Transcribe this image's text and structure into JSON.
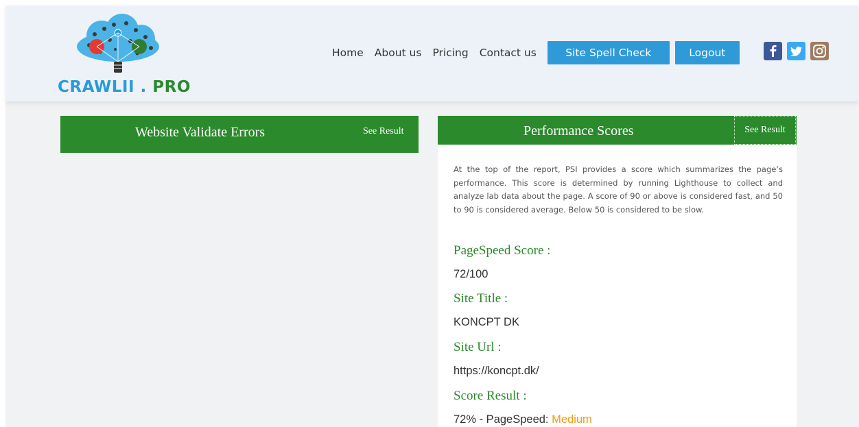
{
  "brand": {
    "name_part1": "CRAWLII . ",
    "name_part2": "PRO"
  },
  "nav": {
    "links": [
      "Home",
      "About us",
      "Pricing",
      "Contact us"
    ],
    "spell_check_label": "Site Spell Check",
    "logout_label": "Logout"
  },
  "social": [
    "facebook-icon",
    "twitter-icon",
    "instagram-icon"
  ],
  "colors": {
    "header_bg": "#edf2f9",
    "panel_green": "#2b8a2c",
    "button_blue": "#2f9ad8",
    "medium_orange": "#f39c12"
  },
  "left_panel": {
    "title": "Website Validate Errors",
    "see_result": "See Result"
  },
  "right_panel": {
    "title": "Performance Scores",
    "see_result": "See Result",
    "description": "At the top of the report, PSI provides a score which summarizes the page’s performance. This score is determined by running Lighthouse to collect and analyze lab data about the page. A score of 90 or above is considered fast, and 50 to 90 is considered average. Below 50 is considered to be slow.",
    "pagespeed_label": "PageSpeed Score :",
    "pagespeed_value": "72/100",
    "site_title_label": "Site Title :",
    "site_title_value": "KONCPT DK",
    "site_url_label": "Site Url :",
    "site_url_value": "https://koncpt.dk/",
    "score_result_label": "Score Result :",
    "score_result_prefix": "72% - PageSpeed: ",
    "score_result_rating": "Medium"
  }
}
